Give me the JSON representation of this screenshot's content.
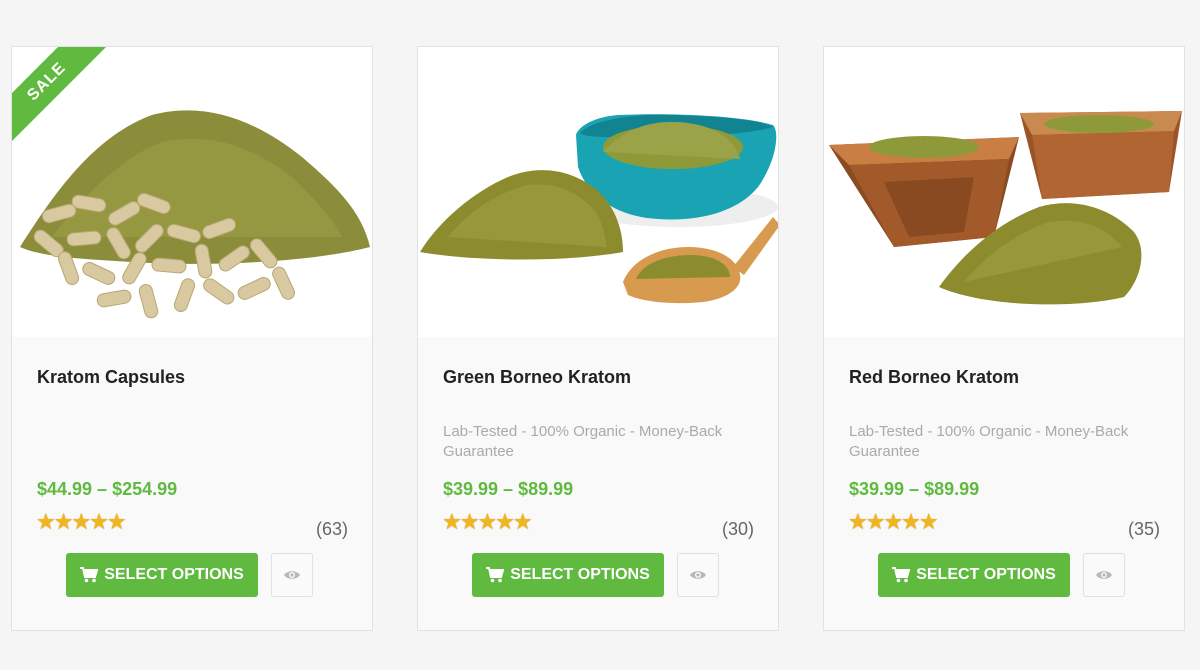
{
  "colors": {
    "accent": "#5fba3f",
    "star": "#f3b51d",
    "text": "#222222",
    "muted": "#aaaaaa"
  },
  "products": [
    {
      "badge": "SALE",
      "name": "Kratom Capsules",
      "description": "",
      "price": "$44.99 – $254.99",
      "stars": "★★★★★",
      "rating": 5,
      "reviews": "(63)",
      "button_label": "SELECT OPTIONS",
      "button_icon": "cart-icon",
      "quick_view_icon": "eye-icon"
    },
    {
      "name": "Green Borneo Kratom",
      "description": "Lab-Tested - 100% Organic - Money-Back Guarantee",
      "price": "$39.99 – $89.99",
      "stars": "★★★★★",
      "rating": 5,
      "reviews": "(30)",
      "button_label": "SELECT OPTIONS",
      "button_icon": "cart-icon",
      "quick_view_icon": "eye-icon"
    },
    {
      "name": "Red Borneo Kratom",
      "description": "Lab-Tested - 100% Organic - Money-Back Guarantee",
      "price": "$39.99 – $89.99",
      "stars": "★★★★★",
      "rating": 5,
      "reviews": "(35)",
      "button_label": "SELECT OPTIONS",
      "button_icon": "cart-icon",
      "quick_view_icon": "eye-icon"
    }
  ]
}
